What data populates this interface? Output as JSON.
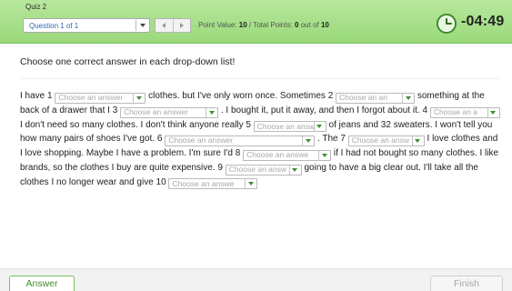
{
  "header": {
    "quiz_title": "Quiz 2",
    "question_selector": "Question 1 of 1",
    "points_label": "Point Value:",
    "point_value": "10",
    "separator": "/",
    "total_label": "Total Points:",
    "total_points": "0",
    "out_of_label": "out of",
    "out_of": "10",
    "timer": "-04:49",
    "accent_color": "#9ad97b"
  },
  "instruction": "Choose one correct answer in each drop-down list!",
  "passage": {
    "segments": [
      {
        "text": "I have 1 "
      },
      {
        "dropdown": "Choose an answer",
        "width": 100
      },
      {
        "text": " clothes. but I've only worn once. Sometimes 2 "
      },
      {
        "dropdown": "Choose an an",
        "width": 87
      },
      {
        "text": " something at the back of a drawer that I 3 "
      },
      {
        "dropdown": "Choose an answer",
        "width": 108
      },
      {
        "text": " . I bought it, put it away, and then I forgot about it. 4 "
      },
      {
        "dropdown": "Choose an a",
        "width": 77
      },
      {
        "text": " I don't need so many clothes. I don't think anyone really 5 "
      },
      {
        "dropdown": "Choose an answ",
        "width": 80
      },
      {
        "text": " of jeans and 32 sweaters. I won't tell you how many pairs of shoes I've got. 6 "
      },
      {
        "dropdown": "Choose an answer",
        "width": 165
      },
      {
        "text": " . The 7 "
      },
      {
        "dropdown": "Choose an answ",
        "width": 84
      },
      {
        "text": " I love clothes and I love shopping. Maybe I have a problem. I'm sure I'd 8 "
      },
      {
        "dropdown": "Choose an answe",
        "width": 97
      },
      {
        "text": " if I had not bought so many clothes. I like brands, so the clothes I buy are quite expensive. 9 "
      },
      {
        "dropdown": "Choose an answ",
        "width": 84
      },
      {
        "text": " going to have a big clear out. I'll take all the clothes I no longer wear and give 10 "
      },
      {
        "dropdown": "Choose an answe",
        "width": 98
      }
    ]
  },
  "footer": {
    "answer_label": "Answer",
    "finish_label": "Finish"
  }
}
